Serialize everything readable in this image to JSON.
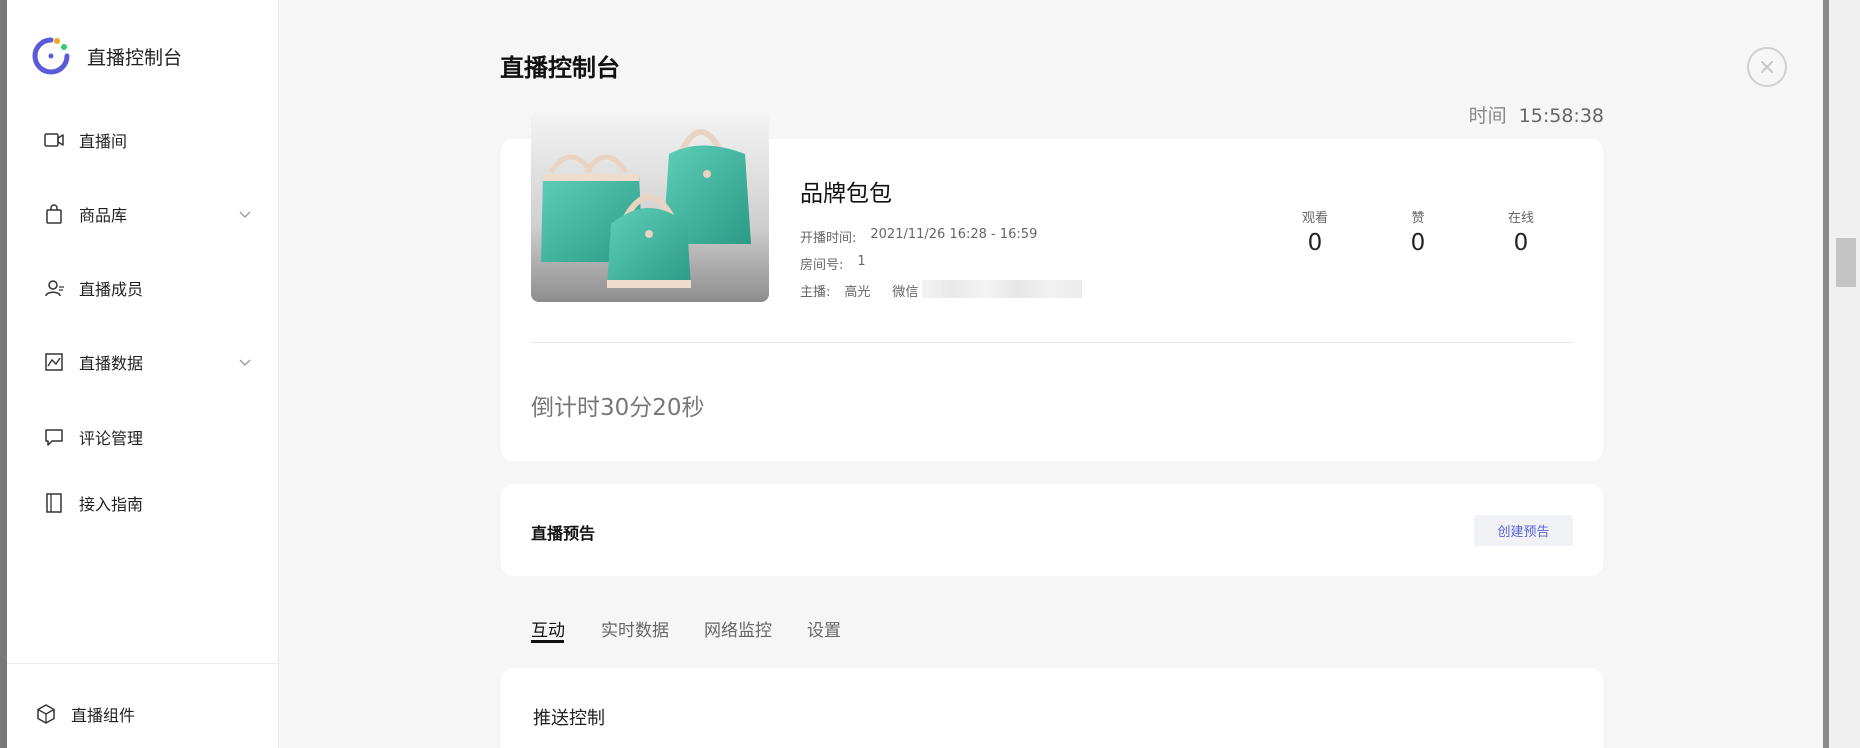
{
  "sidebar": {
    "brand": "直播控制台",
    "items": [
      {
        "label": "直播间",
        "icon": "video-camera-icon",
        "has_submenu": false
      },
      {
        "label": "商品库",
        "icon": "shopping-bag-icon",
        "has_submenu": true
      },
      {
        "label": "直播成员",
        "icon": "members-icon",
        "has_submenu": false
      },
      {
        "label": "直播数据",
        "icon": "chart-icon",
        "has_submenu": true
      },
      {
        "label": "评论管理",
        "icon": "comment-icon",
        "has_submenu": false
      },
      {
        "label": "接入指南",
        "icon": "book-icon",
        "has_submenu": false
      }
    ],
    "bottom_item": {
      "label": "直播组件",
      "icon": "cube-icon"
    }
  },
  "header": {
    "title": "直播控制台",
    "time_label": "时间",
    "time_value": "15:58:38"
  },
  "room": {
    "title": "品牌包包",
    "start_label": "开播时间:",
    "start_value": "2021/11/26 16:28 - 16:59",
    "room_no_label": "房间号:",
    "room_no_value": "1",
    "host_label": "主播:",
    "host_value": "高光",
    "wechat_label": "微信",
    "stats": [
      {
        "label": "观看",
        "value": "0"
      },
      {
        "label": "赞",
        "value": "0"
      },
      {
        "label": "在线",
        "value": "0"
      }
    ],
    "countdown": "倒计时30分20秒"
  },
  "preview": {
    "title": "直播预告",
    "create_button": "创建预告"
  },
  "tabs": [
    "互动",
    "实时数据",
    "网络监控",
    "设置"
  ],
  "push": {
    "title": "推送控制"
  },
  "colors": {
    "accent": "#5b63d9",
    "background": "#f6f6f6"
  }
}
